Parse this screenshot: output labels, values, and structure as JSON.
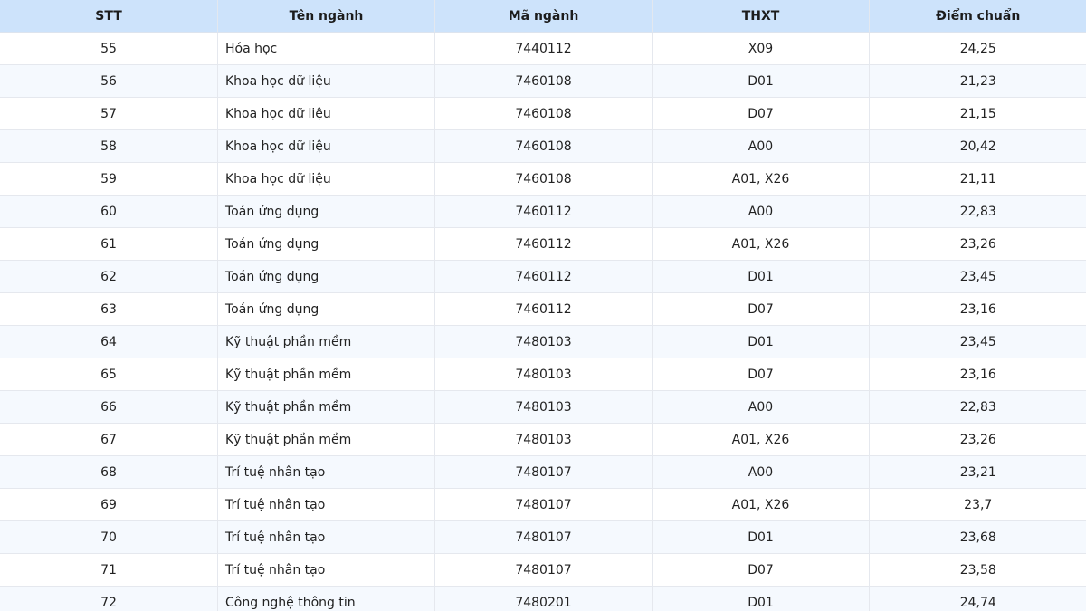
{
  "table": {
    "headers": [
      "STT",
      "Tên ngành",
      "Mã ngành",
      "THXT",
      "Điểm chuẩn"
    ],
    "rows": [
      [
        "55",
        "Hóa học",
        "7440112",
        "X09",
        "24,25"
      ],
      [
        "56",
        "Khoa học dữ liệu",
        "7460108",
        "D01",
        "21,23"
      ],
      [
        "57",
        "Khoa học dữ liệu",
        "7460108",
        "D07",
        "21,15"
      ],
      [
        "58",
        "Khoa học dữ liệu",
        "7460108",
        "A00",
        "20,42"
      ],
      [
        "59",
        "Khoa học dữ liệu",
        "7460108",
        "A01, X26",
        "21,11"
      ],
      [
        "60",
        "Toán ứng dụng",
        "7460112",
        "A00",
        "22,83"
      ],
      [
        "61",
        "Toán ứng dụng",
        "7460112",
        "A01, X26",
        "23,26"
      ],
      [
        "62",
        "Toán ứng dụng",
        "7460112",
        "D01",
        "23,45"
      ],
      [
        "63",
        "Toán ứng dụng",
        "7460112",
        "D07",
        "23,16"
      ],
      [
        "64",
        "Kỹ thuật phần mềm",
        "7480103",
        "D01",
        "23,45"
      ],
      [
        "65",
        "Kỹ thuật phần mềm",
        "7480103",
        "D07",
        "23,16"
      ],
      [
        "66",
        "Kỹ thuật phần mềm",
        "7480103",
        "A00",
        "22,83"
      ],
      [
        "67",
        "Kỹ thuật phần mềm",
        "7480103",
        "A01, X26",
        "23,26"
      ],
      [
        "68",
        "Trí tuệ nhân tạo",
        "7480107",
        "A00",
        "23,21"
      ],
      [
        "69",
        "Trí tuệ nhân tạo",
        "7480107",
        "A01, X26",
        "23,7"
      ],
      [
        "70",
        "Trí tuệ nhân tạo",
        "7480107",
        "D01",
        "23,68"
      ],
      [
        "71",
        "Trí tuệ nhân tạo",
        "7480107",
        "D07",
        "23,58"
      ],
      [
        "72",
        "Công nghệ thông tin",
        "7480201",
        "D01",
        "24,74"
      ]
    ]
  }
}
